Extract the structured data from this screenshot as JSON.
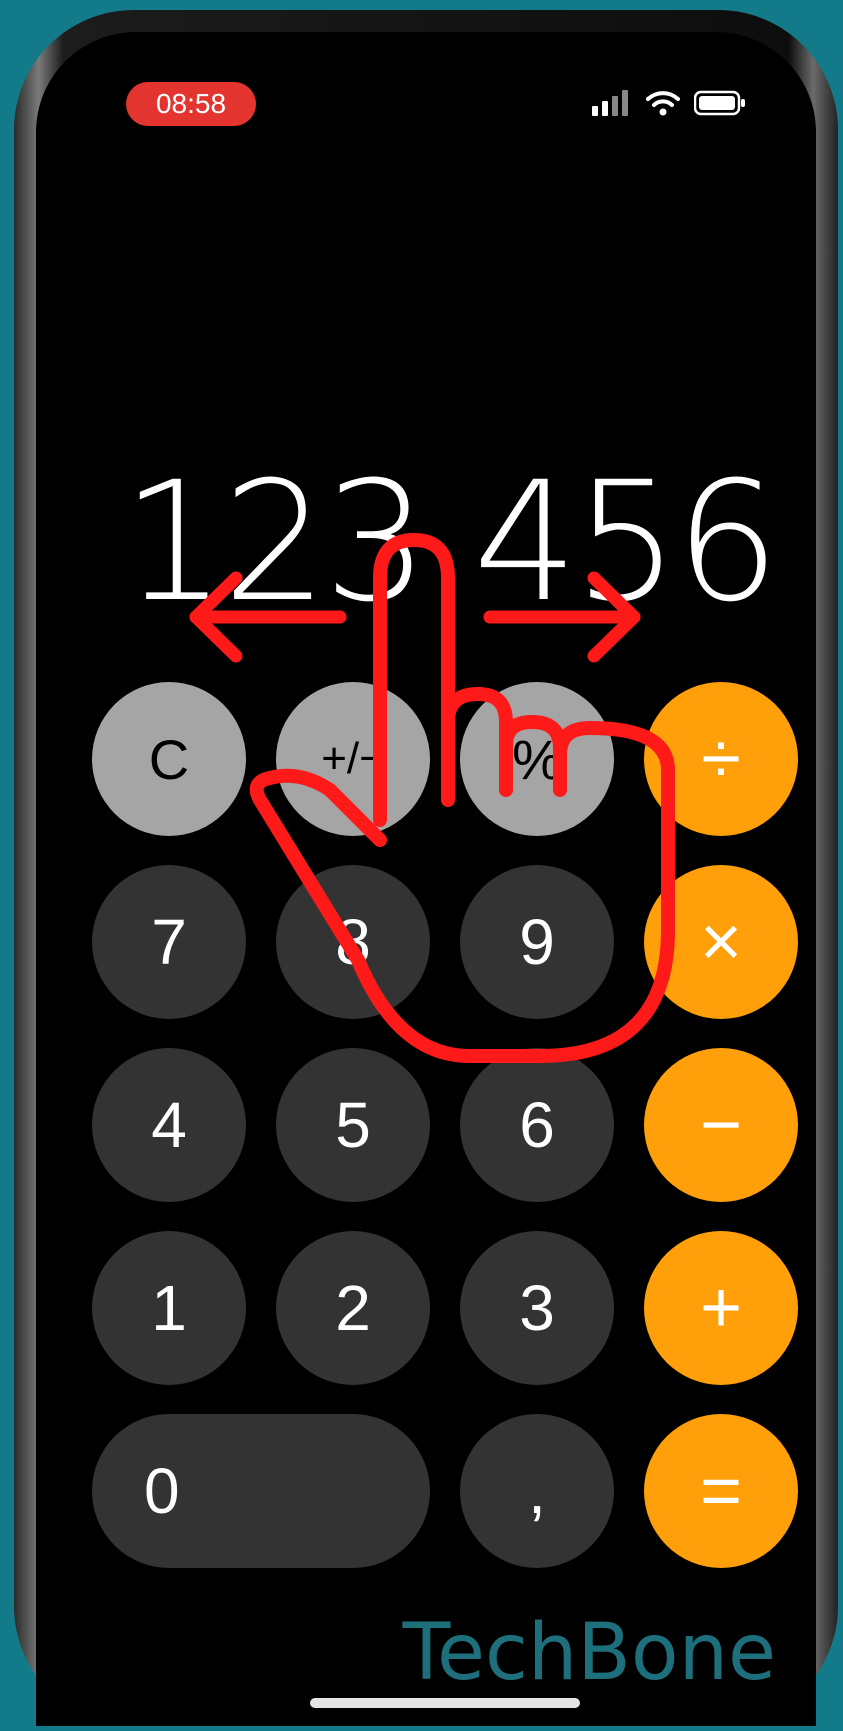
{
  "status_bar": {
    "time": "08:58"
  },
  "display": {
    "value": "123.456"
  },
  "keys": {
    "clear": "C",
    "plus_minus": "+/−",
    "percent": "%",
    "divide": "÷",
    "seven": "7",
    "eight": "8",
    "nine": "9",
    "multiply": "×",
    "four": "4",
    "five": "5",
    "six": "6",
    "minus": "−",
    "one": "1",
    "two": "2",
    "three": "3",
    "plus": "+",
    "zero": "0",
    "decimal": ",",
    "equals": "="
  },
  "watermark": "TechBone",
  "colors": {
    "background": "#127a89",
    "operator_key": "#ff9f0a",
    "function_key": "#a5a5a5",
    "digit_key": "#333333",
    "gesture_overlay": "#ff1a1a",
    "time_pill": "#e3342f"
  },
  "icons": [
    "signal-icon",
    "wifi-icon",
    "battery-icon",
    "swipe-hand-icon",
    "arrow-left-icon",
    "arrow-right-icon"
  ]
}
